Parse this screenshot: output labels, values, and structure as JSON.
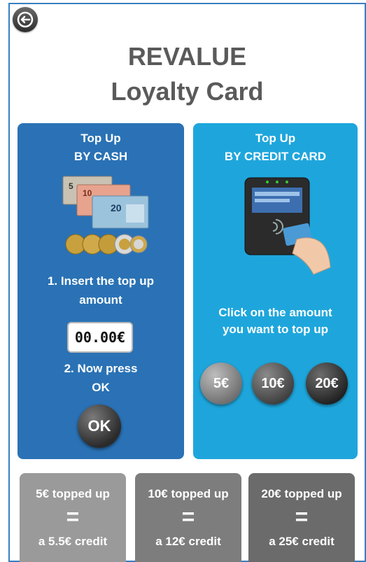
{
  "header": {
    "title_line1": "REVALUE",
    "title_line2": "Loyalty Card"
  },
  "cash_panel": {
    "title_line1": "Top Up",
    "title_line2": "BY CASH",
    "step1_line1": "1. Insert the top up",
    "step1_line2": "amount",
    "amount_value": "00.00€",
    "step2_line1": "2. Now press",
    "step2_line2": "OK",
    "ok_label": "OK",
    "images": [
      "euro-banknotes-icon",
      "euro-coins-icon"
    ]
  },
  "card_panel": {
    "title_line1": "Top Up",
    "title_line2": "BY CREDIT CARD",
    "instruction_line1": "Click on the amount",
    "instruction_line2": "you want to top up",
    "image": "card-terminal-icon",
    "amounts": [
      "5€",
      "10€",
      "20€"
    ]
  },
  "offers": [
    {
      "line1": "5€ topped up",
      "equals": "=",
      "line2": "a 5.5€ credit"
    },
    {
      "line1": "10€ topped up",
      "equals": "=",
      "line2": "a 12€ credit"
    },
    {
      "line1": "20€ topped up",
      "equals": "=",
      "line2": "a 25€ credit"
    }
  ],
  "colors": {
    "frame_border": "#3a7fc0",
    "cash_panel": "#2a72b5",
    "card_panel": "#1ea6dc",
    "title_text": "#5a5a5a"
  }
}
